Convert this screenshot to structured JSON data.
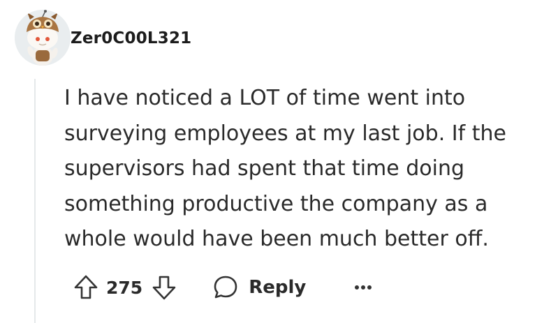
{
  "comment": {
    "username": "Zer0C00L321",
    "avatar_icon": "snoo-avatar-icon",
    "body_lines": [
      "I have noticed a LOT of time went into",
      "surveying employees at my last job. If the",
      "supervisors had spent that time doing",
      "something productive the company as a",
      "whole would have been much better off."
    ]
  },
  "actions": {
    "upvote_icon": "arrow-up-icon",
    "vote_count": "275",
    "downvote_icon": "arrow-down-icon",
    "reply_icon": "speech-bubble-icon",
    "reply_label": "Reply",
    "more_icon": "ellipsis-icon"
  },
  "colors": {
    "text": "#1c1c1c",
    "thread_line": "#e5e8ea",
    "avatar_bg": "#e9edef"
  }
}
